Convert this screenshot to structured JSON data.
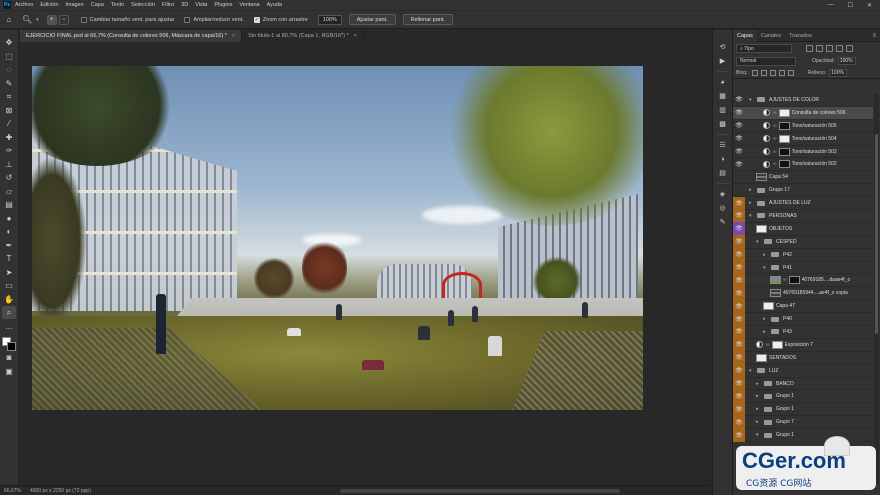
{
  "menu": {
    "logo": "Ps",
    "items": [
      "Archivo",
      "Edición",
      "Imagen",
      "Capa",
      "Texto",
      "Selección",
      "Filtro",
      "3D",
      "Vista",
      "Plugins",
      "Ventana",
      "Ayuda"
    ],
    "window_controls": [
      "—",
      "☐",
      "✕"
    ]
  },
  "options": {
    "resize_windows_label": "Cambiar tamaño vent. para ajustar",
    "zoom_all_label": "Ampliar/reducir vent.",
    "scrubby_zoom_label": "Zoom con arrastre",
    "zoom_value": "100%",
    "fit_screen_label": "Ajustar pant.",
    "fill_screen_label": "Rellenar pant."
  },
  "tabs": [
    {
      "label": "EJERCICIO FINAL.psd al 66,7% (Consulta de colores 506, Máscara de capa/16) *",
      "close": "×"
    },
    {
      "label": "Sin título-1 al 80,7% (Capa 1, RGB/16*) *",
      "close": "×"
    }
  ],
  "status": {
    "zoom": "66,67%",
    "doc_size": "4000 px x 2250 px (72 ppp)"
  },
  "panel": {
    "tabs": [
      "Capas",
      "Canales",
      "Trazados"
    ],
    "filter_kind": "Tipo",
    "blend_mode": "Normal",
    "opacity_label": "Opacidad:",
    "opacity_value": "100%",
    "lock_label": "Bloq.:",
    "fill_label": "Relleno:",
    "fill_value": "100%"
  },
  "layers": [
    {
      "name": "AJUSTES DE COLOR",
      "type": "group",
      "indent": 0,
      "eye": "on",
      "expanded": true
    },
    {
      "name": "Consulta de colores 506",
      "type": "adjust",
      "indent": 2,
      "eye": "on",
      "selected": true
    },
    {
      "name": "Tono/saturación 505",
      "type": "adjust-dark",
      "indent": 2,
      "eye": "on"
    },
    {
      "name": "Tono/saturación 504",
      "type": "adjust",
      "indent": 2,
      "eye": "on"
    },
    {
      "name": "Tono/saturación 503",
      "type": "adjust-dark",
      "indent": 2,
      "eye": "on"
    },
    {
      "name": "Tono/saturación 502",
      "type": "adjust-dark",
      "indent": 2,
      "eye": "on"
    },
    {
      "name": "Capa 54",
      "type": "line",
      "indent": 1,
      "eye": "off"
    },
    {
      "name": "Grupo 17",
      "type": "group",
      "indent": 0,
      "eye": "off",
      "expanded": false
    },
    {
      "name": "AJUSTES DE LUZ",
      "type": "group",
      "indent": 0,
      "eye": "orange",
      "expanded": false
    },
    {
      "name": "PERSONAS",
      "type": "group",
      "indent": 0,
      "eye": "orange",
      "expanded": true
    },
    {
      "name": "OBJETOS",
      "type": "thumb",
      "indent": 1,
      "eye": "purple"
    },
    {
      "name": "CÉSPED",
      "type": "group",
      "indent": 1,
      "eye": "orange",
      "expanded": true
    },
    {
      "name": "P42",
      "type": "group",
      "indent": 2,
      "eye": "orange",
      "expanded": false
    },
    {
      "name": "P41",
      "type": "group",
      "indent": 2,
      "eye": "orange",
      "expanded": true
    },
    {
      "name": "40769185....daae4f_o",
      "type": "photo",
      "indent": 3,
      "eye": "orange"
    },
    {
      "name": "40769185944....ae4f_o copia",
      "type": "line",
      "indent": 3,
      "eye": "orange"
    },
    {
      "name": "Capa 47",
      "type": "white",
      "indent": 2,
      "eye": "orange"
    },
    {
      "name": "P40",
      "type": "group",
      "indent": 2,
      "eye": "orange",
      "expanded": false
    },
    {
      "name": "P43",
      "type": "group",
      "indent": 2,
      "eye": "orange",
      "expanded": false
    },
    {
      "name": "Exposición 7",
      "type": "adjust",
      "indent": 1,
      "eye": "orange"
    },
    {
      "name": "SENTADOS",
      "type": "thumb",
      "indent": 1,
      "eye": "orange"
    },
    {
      "name": "LUZ",
      "type": "group",
      "indent": 0,
      "eye": "orange",
      "expanded": true
    },
    {
      "name": "BANCO",
      "type": "group",
      "indent": 1,
      "eye": "orange",
      "expanded": false
    },
    {
      "name": "Grupo 1",
      "type": "group",
      "indent": 1,
      "eye": "orange",
      "expanded": false
    },
    {
      "name": "Grupo 1",
      "type": "group",
      "indent": 1,
      "eye": "orange",
      "expanded": false
    },
    {
      "name": "Grupo 7",
      "type": "group",
      "indent": 1,
      "eye": "orange",
      "expanded": false
    },
    {
      "name": "Grupo 1",
      "type": "group",
      "indent": 1,
      "eye": "orange",
      "expanded": true
    }
  ],
  "watermark": {
    "main": "CGer.com",
    "sub": "CG资源 CG网站"
  },
  "colors": {
    "orange_tag": "#a5661c",
    "purple_tag": "#7a4aa8",
    "selected_row": "#4b4b4b"
  }
}
